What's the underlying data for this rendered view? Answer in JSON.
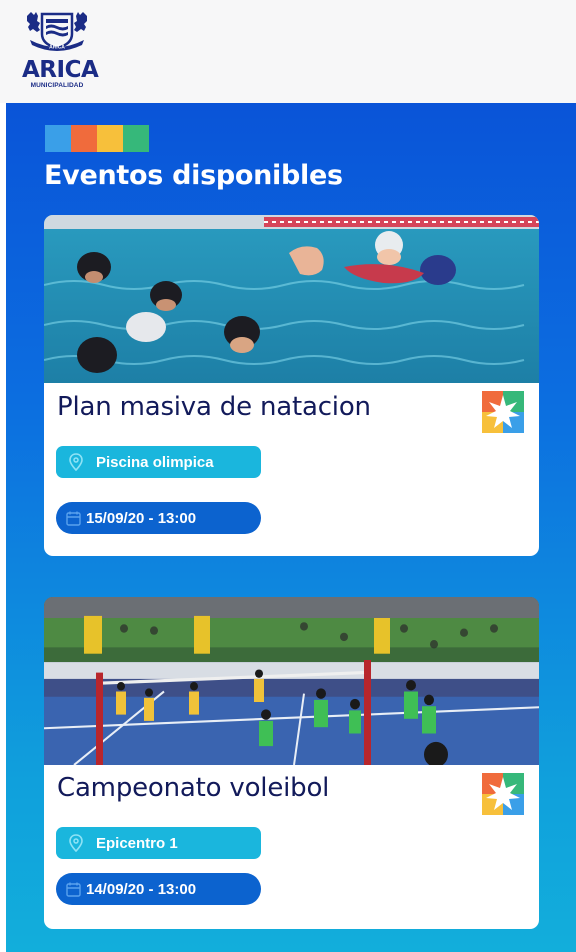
{
  "header": {
    "brand": "ARICA",
    "brand_sub": "MUNICIPALIDAD",
    "crest_text": "ARICA"
  },
  "colors": {
    "stripe": [
      "#3a9fe8",
      "#f06b3c",
      "#f7c03b",
      "#36b87a"
    ],
    "navy": "#121a5a",
    "location_pill": "#1ab6dd",
    "date_pill": "#0c63cf"
  },
  "main": {
    "section_title": "Eventos disponibles",
    "events": [
      {
        "title": "Plan masiva de natacion",
        "location": "Piscina olimpica",
        "datetime": "15/09/20 - 13:00",
        "image": "swimming-pool-photo"
      },
      {
        "title": "Campeonato voleibol",
        "location": "Epicentro 1",
        "datetime": "14/09/20 - 13:00",
        "image": "volleyball-court-photo"
      }
    ]
  }
}
